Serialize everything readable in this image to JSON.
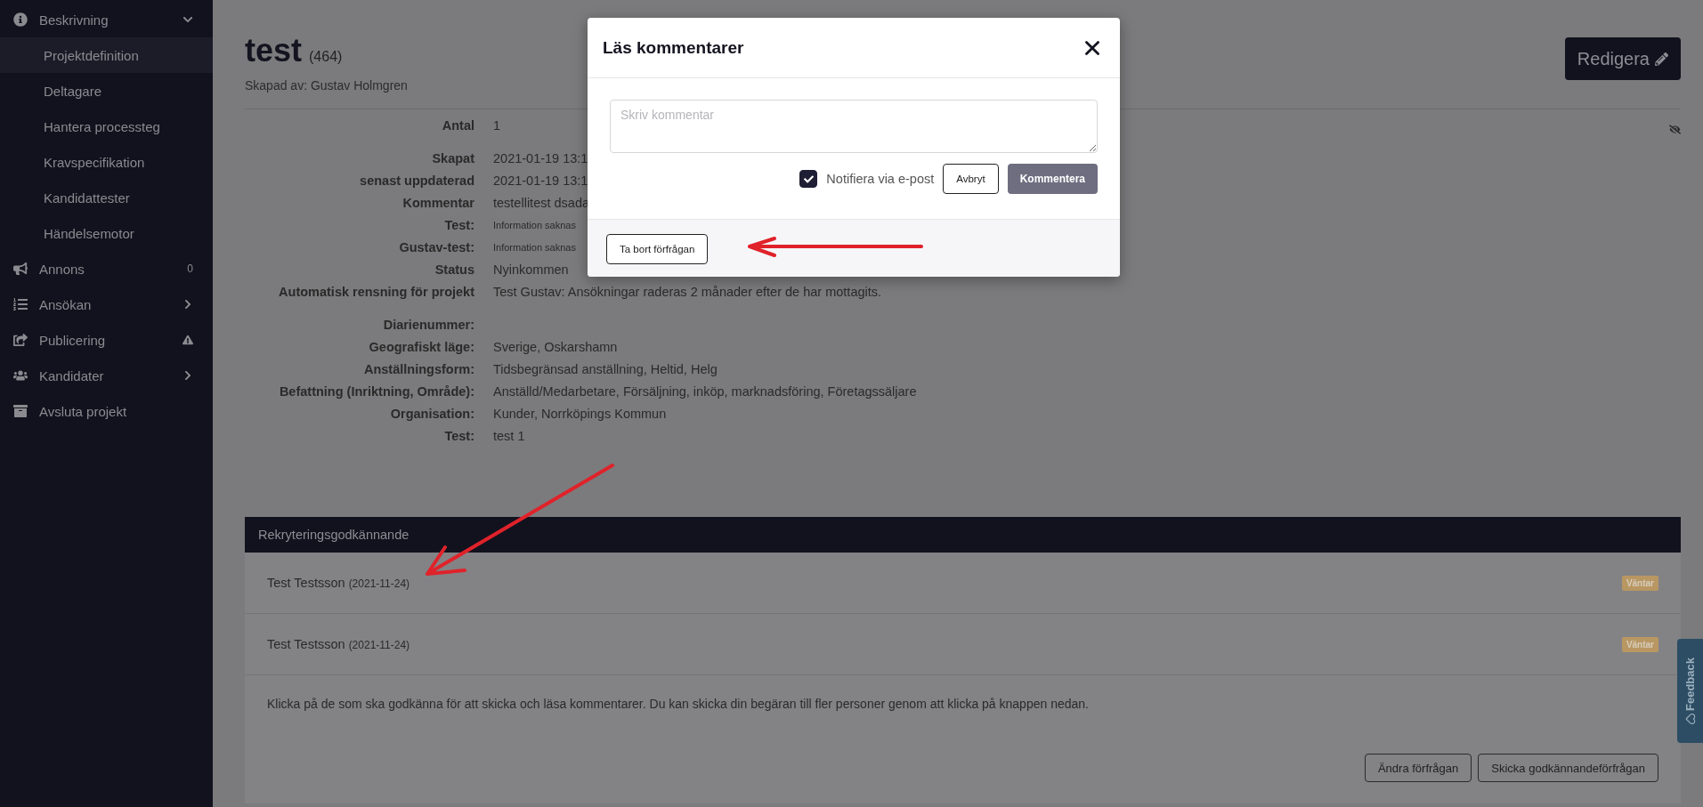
{
  "sidebar": {
    "items": [
      {
        "label": "Beskrivning",
        "expanded": true,
        "children": [
          {
            "label": "Projektdefinition",
            "selected": true
          },
          {
            "label": "Deltagare",
            "selected": false
          },
          {
            "label": "Hantera processteg",
            "selected": false
          },
          {
            "label": "Kravspecifikation",
            "selected": false
          },
          {
            "label": "Kandidattester",
            "selected": false
          },
          {
            "label": "Händelsemotor",
            "selected": false
          }
        ]
      },
      {
        "label": "Annons",
        "badge": "0"
      },
      {
        "label": "Ansökan",
        "expanded": false
      },
      {
        "label": "Publicering",
        "warning": true
      },
      {
        "label": "Kandidater",
        "expanded": false
      },
      {
        "label": "Avsluta projekt"
      }
    ]
  },
  "header": {
    "title": "test",
    "number": "(464)",
    "created_by": "Skapad av: Gustav Holmgren",
    "edit_button": "Redigera"
  },
  "details": {
    "groups": [
      [
        {
          "label": "Antal",
          "value": "1"
        }
      ],
      [
        {
          "label": "Skapat",
          "value": "2021-01-19 13:1"
        },
        {
          "label": "senast uppdaterad",
          "value": "2021-01-19 13:1"
        },
        {
          "label": "Kommentar",
          "value": "testellitest dsada"
        },
        {
          "label": "Test:",
          "value": "Information saknas",
          "muted": true
        },
        {
          "label": "Gustav-test:",
          "value": "Information saknas",
          "muted": true
        },
        {
          "label": "Status",
          "value": "Nyinkommen"
        },
        {
          "label": "Automatisk rensning för projekt",
          "value": "Test Gustav: Ansökningar raderas 2 månader efter de har mottagits."
        }
      ],
      [
        {
          "label": "Diarienummer:"
        },
        {
          "label": "Geografiskt läge:",
          "value": "Sverige, Oskarshamn"
        },
        {
          "label": "Anställningsform:",
          "value": "Tidsbegränsad anställning, Heltid, Helg"
        },
        {
          "label": "Befattning (Inriktning, Område):",
          "value": "Anställd/Medarbetare, Försäljning, inköp, marknadsföring, Företagssäljare"
        },
        {
          "label": "Organisation:",
          "value": "Kunder, Norrköpings Kommun"
        },
        {
          "label": "Test:",
          "value": "test 1"
        }
      ]
    ]
  },
  "approval": {
    "title": "Rekryteringsgodkännande",
    "rows": [
      {
        "name": "Test Testsson",
        "date": "(2021-11-24)",
        "status": "Väntar"
      },
      {
        "name": "Test Testsson",
        "date": "(2021-11-24)",
        "status": "Väntar"
      }
    ],
    "info": "Klicka på de som ska godkänna för att skicka och läsa kommentarer. Du kan skicka din begäran till fler personer genom att klicka på knappen nedan.",
    "buttons": [
      "Ändra förfrågan",
      "Skicka godkännandeförfrågan"
    ]
  },
  "modal": {
    "title": "Läs kommentarer",
    "placeholder": "Skriv kommentar",
    "notify": {
      "label": "Notifiera via e-post",
      "checked": true
    },
    "cancel": "Avbryt",
    "submit": "Kommentera",
    "remove": "Ta bort förfrågan"
  },
  "feedback": "Feedback"
}
